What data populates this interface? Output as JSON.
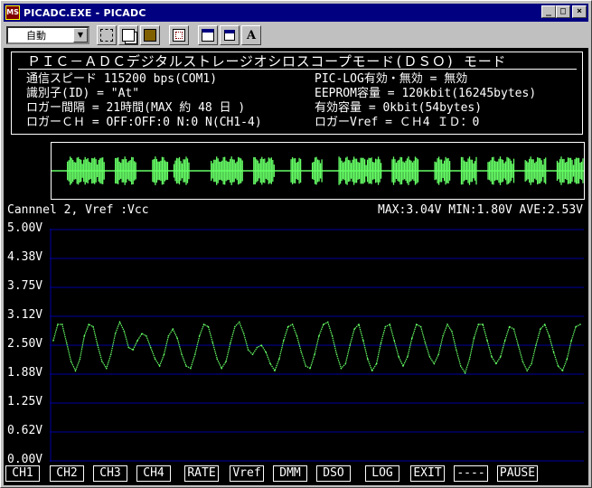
{
  "window": {
    "title": "PICADC.EXE - PICADC",
    "app_icon_label": "MS"
  },
  "window_buttons": {
    "minimize": "_",
    "maximize": "□",
    "close": "×"
  },
  "toolbar": {
    "zoom_value": "自動",
    "font_button_label": "A"
  },
  "info": {
    "title": "ＰＩＣ－ＡＤＣデジタルストレージオシロスコープモード(ＤＳＯ) モード",
    "lines": [
      "通信スピード   115200 bps(COM1)",
      "識別子(ID) = \"At\"",
      "ロガー間隔 = 21時間(MAX 約  48 日 )",
      "ロガーＣＨ = OFF:OFF:0 N:0 N(CH1-4)"
    ],
    "right_lines": [
      "PIC-LOG有効・無効 = 無効",
      "EEPROM容量 = 120kbit(16245bytes)",
      "有効容量   = 0kbit(54bytes)",
      "ロガーVref = ＣＨ4   ＩＤ：0"
    ]
  },
  "channel_label": "Cannnel 2, Vref :Vcc",
  "stats": "MAX:3.04V MIN:1.80V AVE:2.53V",
  "colors": {
    "trace": "#66ff66",
    "grid": "#0000a0",
    "text": "#ffffff",
    "background": "#000000"
  },
  "chart_data": {
    "type": "line",
    "series": [
      {
        "values": [
          2.6,
          2.95,
          2.95,
          2.55,
          2.15,
          1.95,
          2.2,
          2.7,
          2.95,
          2.9,
          2.5,
          2.15,
          2.0,
          2.3,
          2.75,
          3.0,
          2.8,
          2.45,
          2.4,
          2.6,
          2.75,
          2.7,
          2.45,
          2.2,
          2.05,
          2.3,
          2.7,
          2.85,
          2.65,
          2.3,
          2.05,
          2.0,
          2.3,
          2.7,
          2.95,
          2.9,
          2.55,
          2.2,
          2.0,
          2.15,
          2.55,
          2.9,
          3.0,
          2.75,
          2.4,
          2.3,
          2.45,
          2.5,
          2.35,
          2.1,
          1.95,
          2.2,
          2.6,
          2.9,
          2.95,
          2.7,
          2.35,
          2.05,
          2.0,
          2.3,
          2.7,
          2.95,
          3.0,
          2.7,
          2.3,
          2.0,
          2.1,
          2.5,
          2.85,
          2.95,
          2.6,
          2.2,
          1.95,
          2.1,
          2.55,
          2.9,
          2.95,
          2.6,
          2.25,
          2.05,
          2.25,
          2.65,
          2.95,
          2.9,
          2.55,
          2.25,
          2.1,
          2.3,
          2.7,
          2.95,
          2.8,
          2.4,
          2.05,
          1.9,
          2.2,
          2.65,
          2.95,
          2.95,
          2.6,
          2.25,
          2.1,
          2.25,
          2.6,
          2.9,
          2.85,
          2.5,
          2.15,
          1.95,
          2.1,
          2.5,
          2.85,
          2.95,
          2.7,
          2.35,
          2.05,
          1.95,
          2.2,
          2.6,
          2.9,
          2.95
        ]
      }
    ],
    "ylim": [
      0,
      5
    ],
    "yticks": [
      "5.00V",
      "4.38V",
      "3.75V",
      "3.12V",
      "2.50V",
      "1.88V",
      "1.25V",
      "0.62V",
      "0.00V"
    ],
    "grid": true
  },
  "overview_wave": {
    "segments": [
      [
        0.03,
        0.1
      ],
      [
        0.12,
        0.16
      ],
      [
        0.19,
        0.22
      ],
      [
        0.23,
        0.26
      ],
      [
        0.3,
        0.36
      ],
      [
        0.38,
        0.42
      ],
      [
        0.45,
        0.47
      ],
      [
        0.49,
        0.51
      ],
      [
        0.54,
        0.62
      ],
      [
        0.64,
        0.69
      ],
      [
        0.72,
        0.75
      ],
      [
        0.77,
        0.8
      ],
      [
        0.82,
        0.87
      ],
      [
        0.89,
        0.93
      ],
      [
        0.95,
        1.0
      ]
    ]
  },
  "function_keys": [
    "CH1",
    "CH2",
    "CH3",
    "CH4",
    "RATE",
    "Vref",
    "DMM",
    "DSO",
    "LOG",
    "EXIT",
    "----",
    "PAUSE"
  ]
}
